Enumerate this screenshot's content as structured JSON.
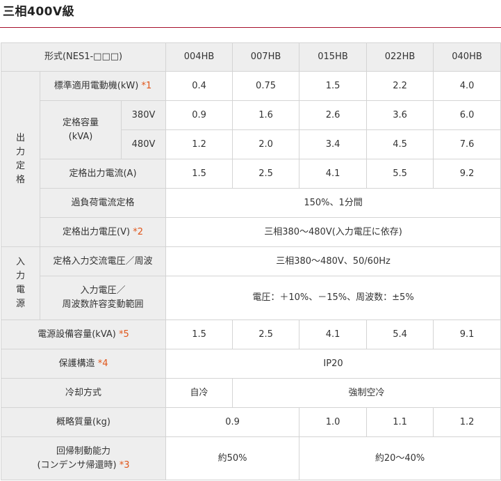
{
  "title": "三相400V級",
  "table": {
    "header": {
      "label": "形式(NES1-□□□)",
      "models": [
        "004HB",
        "007HB",
        "015HB",
        "022HB",
        "040HB"
      ]
    },
    "group_output": "出力定格",
    "group_input": "入力電源",
    "motor": {
      "label": "標準適用電動機(kW)",
      "note": "*1",
      "values": [
        "0.4",
        "0.75",
        "1.5",
        "2.2",
        "4.0"
      ]
    },
    "capacity": {
      "label_line1": "定格容量",
      "label_line2": "(kVA)",
      "v380": {
        "label": "380V",
        "values": [
          "0.9",
          "1.6",
          "2.6",
          "3.6",
          "6.0"
        ]
      },
      "v480": {
        "label": "480V",
        "values": [
          "1.2",
          "2.0",
          "3.4",
          "4.5",
          "7.6"
        ]
      }
    },
    "current": {
      "label": "定格出力電流(A)",
      "values": [
        "1.5",
        "2.5",
        "4.1",
        "5.5",
        "9.2"
      ]
    },
    "overload": {
      "label": "過負荷電流定格",
      "value": "150%、1分間"
    },
    "out_voltage": {
      "label": "定格出力電圧(V)",
      "note": "*2",
      "value": "三相380～480V(入力電圧に依存)"
    },
    "in_voltage": {
      "label": "定格入力交流電圧／周波",
      "value": "三相380～480V、50/60Hz"
    },
    "fluctuation": {
      "label_line1": "入力電圧／",
      "label_line2": "周波数許容変動範囲",
      "value": "電圧：＋10%、－15%、周波数：±5%"
    },
    "supply": {
      "label": "電源設備容量(kVA)",
      "note": "*5",
      "values": [
        "1.5",
        "2.5",
        "4.1",
        "5.4",
        "9.1"
      ]
    },
    "protection": {
      "label": "保護構造",
      "note": "*4",
      "value": "IP20"
    },
    "cooling": {
      "label": "冷却方式",
      "value_first": "自冷",
      "value_rest": "強制空冷"
    },
    "mass": {
      "label": "概略質量(kg)",
      "value_12": "0.9",
      "value_3": "1.0",
      "value_4": "1.1",
      "value_5": "1.2"
    },
    "braking": {
      "label_line1": "回帰制動能力",
      "label_line2": "(コンデンサ帰還時)",
      "note": "*3",
      "value_12": "約50%",
      "value_345": "約20～40%"
    }
  }
}
